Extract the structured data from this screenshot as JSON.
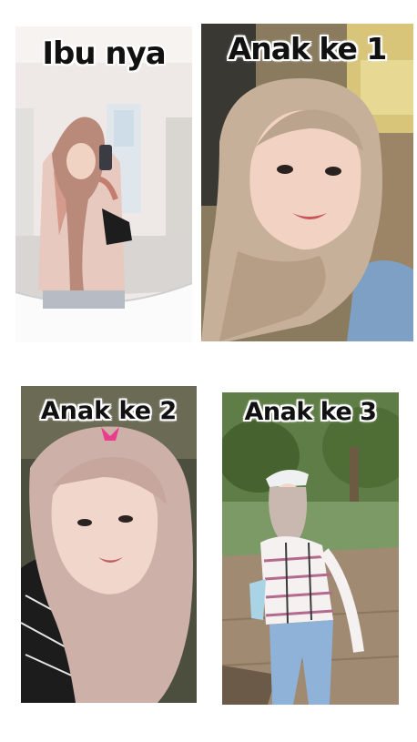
{
  "panels": [
    {
      "caption": "Ibu nya"
    },
    {
      "caption": "Anak ke 1"
    },
    {
      "caption": "Anak ke  2"
    },
    {
      "caption": "Anak ke 3"
    }
  ]
}
